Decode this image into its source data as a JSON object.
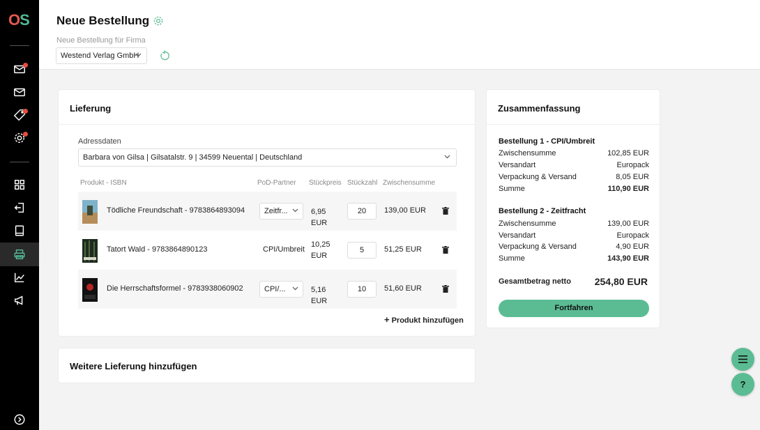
{
  "app": {
    "logo_o": "O",
    "logo_s": "S"
  },
  "sidebar": {
    "items": [
      {
        "icon": "mail-notification-icon",
        "badge": true
      },
      {
        "icon": "mail-icon",
        "badge": false
      },
      {
        "icon": "tag-icon",
        "badge": true
      },
      {
        "icon": "settings-icon",
        "badge": true
      },
      {
        "icon": "dashboard-grid-icon",
        "badge": false
      },
      {
        "icon": "import-icon",
        "badge": false
      },
      {
        "icon": "book-icon",
        "badge": false
      },
      {
        "icon": "printer-icon",
        "badge": false,
        "active": true
      },
      {
        "icon": "chart-icon",
        "badge": false
      },
      {
        "icon": "megaphone-icon",
        "badge": false
      },
      {
        "icon": "expand-icon",
        "badge": false
      }
    ]
  },
  "header": {
    "title": "Neue Bestellung",
    "company_label": "Neue Bestellung für Firma",
    "company_value": "Westend Verlag GmbH"
  },
  "delivery": {
    "title": "Lieferung",
    "address_label": "Adressdaten",
    "address_value": "Barbara von Gilsa | Gilsatalstr. 9 | 34599 Neuental | Deutschland",
    "columns": {
      "product": "Produkt - ISBN",
      "partner": "PoD-Partner",
      "price": "Stückpreis",
      "qty": "Stückzahl",
      "subtotal": "Zwischensumme"
    },
    "rows": [
      {
        "name": "Tödliche Freundschaft - 9783864893094",
        "partner": "Zeitfr...",
        "price": "6,95 EUR",
        "qty": "20",
        "subtotal": "139,00 EUR"
      },
      {
        "name": "Tatort Wald - 9783864890123",
        "partner": "CPI/Umbreit",
        "price": "10,25 EUR",
        "qty": "5",
        "subtotal": "51,25 EUR"
      },
      {
        "name": "Die Herrschaftsformel - 9783938060902",
        "partner": "CPI/...",
        "price": "5,16 EUR",
        "qty": "10",
        "subtotal": "51,60 EUR"
      }
    ],
    "add_product": "Produkt hinzufügen"
  },
  "further_delivery": {
    "title": "Weitere Lieferung hinzufügen"
  },
  "summary": {
    "title": "Zusammenfassung",
    "orders": [
      {
        "title": "Bestellung 1 - CPI/Umbreit",
        "lines": [
          {
            "label": "Zwischensumme",
            "value": "102,85 EUR"
          },
          {
            "label": "Versandart",
            "value": "Europack"
          },
          {
            "label": "Verpackung & Versand",
            "value": "8,05 EUR"
          },
          {
            "label": "Summe",
            "value": "110,90 EUR"
          }
        ]
      },
      {
        "title": "Bestellung 2 - Zeitfracht",
        "lines": [
          {
            "label": "Zwischensumme",
            "value": "139,00 EUR"
          },
          {
            "label": "Versandart",
            "value": "Europack"
          },
          {
            "label": "Verpackung & Versand",
            "value": "4,90 EUR"
          },
          {
            "label": "Summe",
            "value": "143,90 EUR"
          }
        ]
      }
    ],
    "total_label": "Gesamtbetrag netto",
    "total_value": "254,80 EUR",
    "proceed_label": "Fortfahren"
  },
  "fab": {
    "help_label": "?"
  },
  "colors": {
    "accent": "#5bbc94",
    "badge": "#e74c3c",
    "sidebar": "#000000"
  }
}
